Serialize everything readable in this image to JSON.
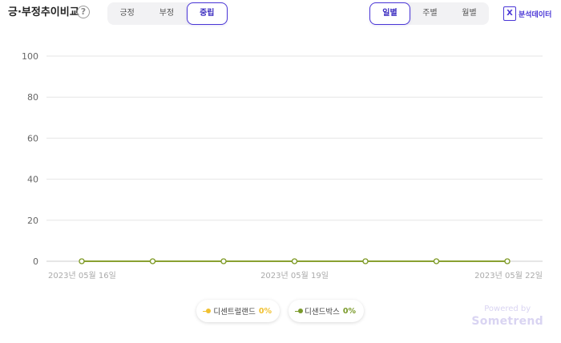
{
  "header": {
    "title": "긍·부정추이비교",
    "help_icon": "question-circle-icon"
  },
  "sentiment_tabs": [
    {
      "label": "긍정",
      "active": false
    },
    {
      "label": "부정",
      "active": false
    },
    {
      "label": "중립",
      "active": true
    }
  ],
  "period_tabs": [
    {
      "label": "일별",
      "active": true
    },
    {
      "label": "주별",
      "active": false
    },
    {
      "label": "월별",
      "active": false
    }
  ],
  "export": {
    "label": "분석데이터",
    "icon": "excel-icon",
    "icon_glyph": "X",
    "color": "#4a36d6"
  },
  "chart_data": {
    "type": "line",
    "x": [
      "2023-05-16",
      "2023-05-17",
      "2023-05-18",
      "2023-05-19",
      "2023-05-20",
      "2023-05-21",
      "2023-05-22"
    ],
    "x_tick_labels": [
      {
        "date": "2023-05-16",
        "label": "2023년 05월 16일"
      },
      {
        "date": "2023-05-19",
        "label": "2023년 05월 19일"
      },
      {
        "date": "2023-05-22",
        "label": "2023년 05월 22일"
      }
    ],
    "y_ticks": [
      0,
      20,
      40,
      60,
      80,
      100
    ],
    "ylim": [
      0,
      100
    ],
    "grid": true,
    "legend_position": "bottom",
    "series": [
      {
        "name": "디센트럴랜드",
        "values": [
          0,
          0,
          0,
          0,
          0,
          0,
          0
        ],
        "percent_label": "0%",
        "color": "#f0c030"
      },
      {
        "name": "디샌드박스",
        "values": [
          0,
          0,
          0,
          0,
          0,
          0,
          0
        ],
        "percent_label": "0%",
        "color": "#7a9a2a"
      }
    ]
  },
  "footer": {
    "powered_by": "Powered by",
    "brand": "Sometrend",
    "brand_color": "#d9d4f2"
  }
}
